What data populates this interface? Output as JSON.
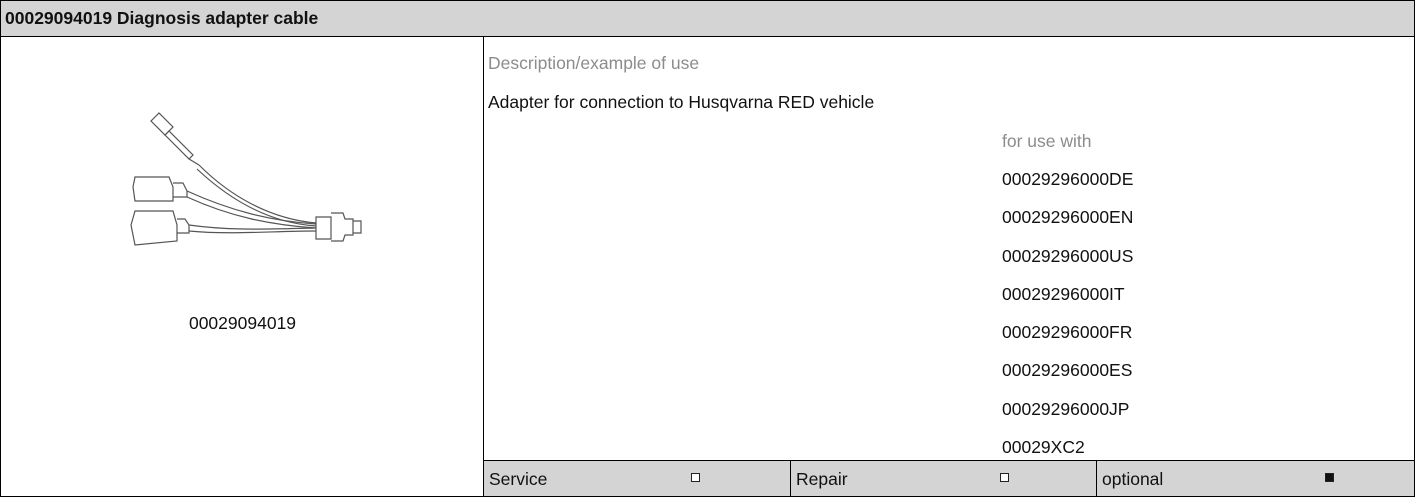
{
  "title": "00029094019 Diagnosis adapter cable",
  "image": {
    "icon": "cable-adapter-illustration",
    "part_number": "00029094019"
  },
  "description": {
    "heading": "Description/example of use",
    "text": "Adapter for connection to Husqvarna RED vehicle"
  },
  "for_use_with": {
    "heading": "for use with",
    "items": [
      "00029296000DE",
      "00029296000EN",
      "00029296000US",
      "00029296000IT",
      "00029296000FR",
      "00029296000ES",
      "00029296000JP",
      "00029XC2"
    ]
  },
  "footer": {
    "service": {
      "label": "Service",
      "checked": false
    },
    "repair": {
      "label": "Repair",
      "checked": false
    },
    "optional": {
      "label": "optional",
      "checked": true
    }
  }
}
